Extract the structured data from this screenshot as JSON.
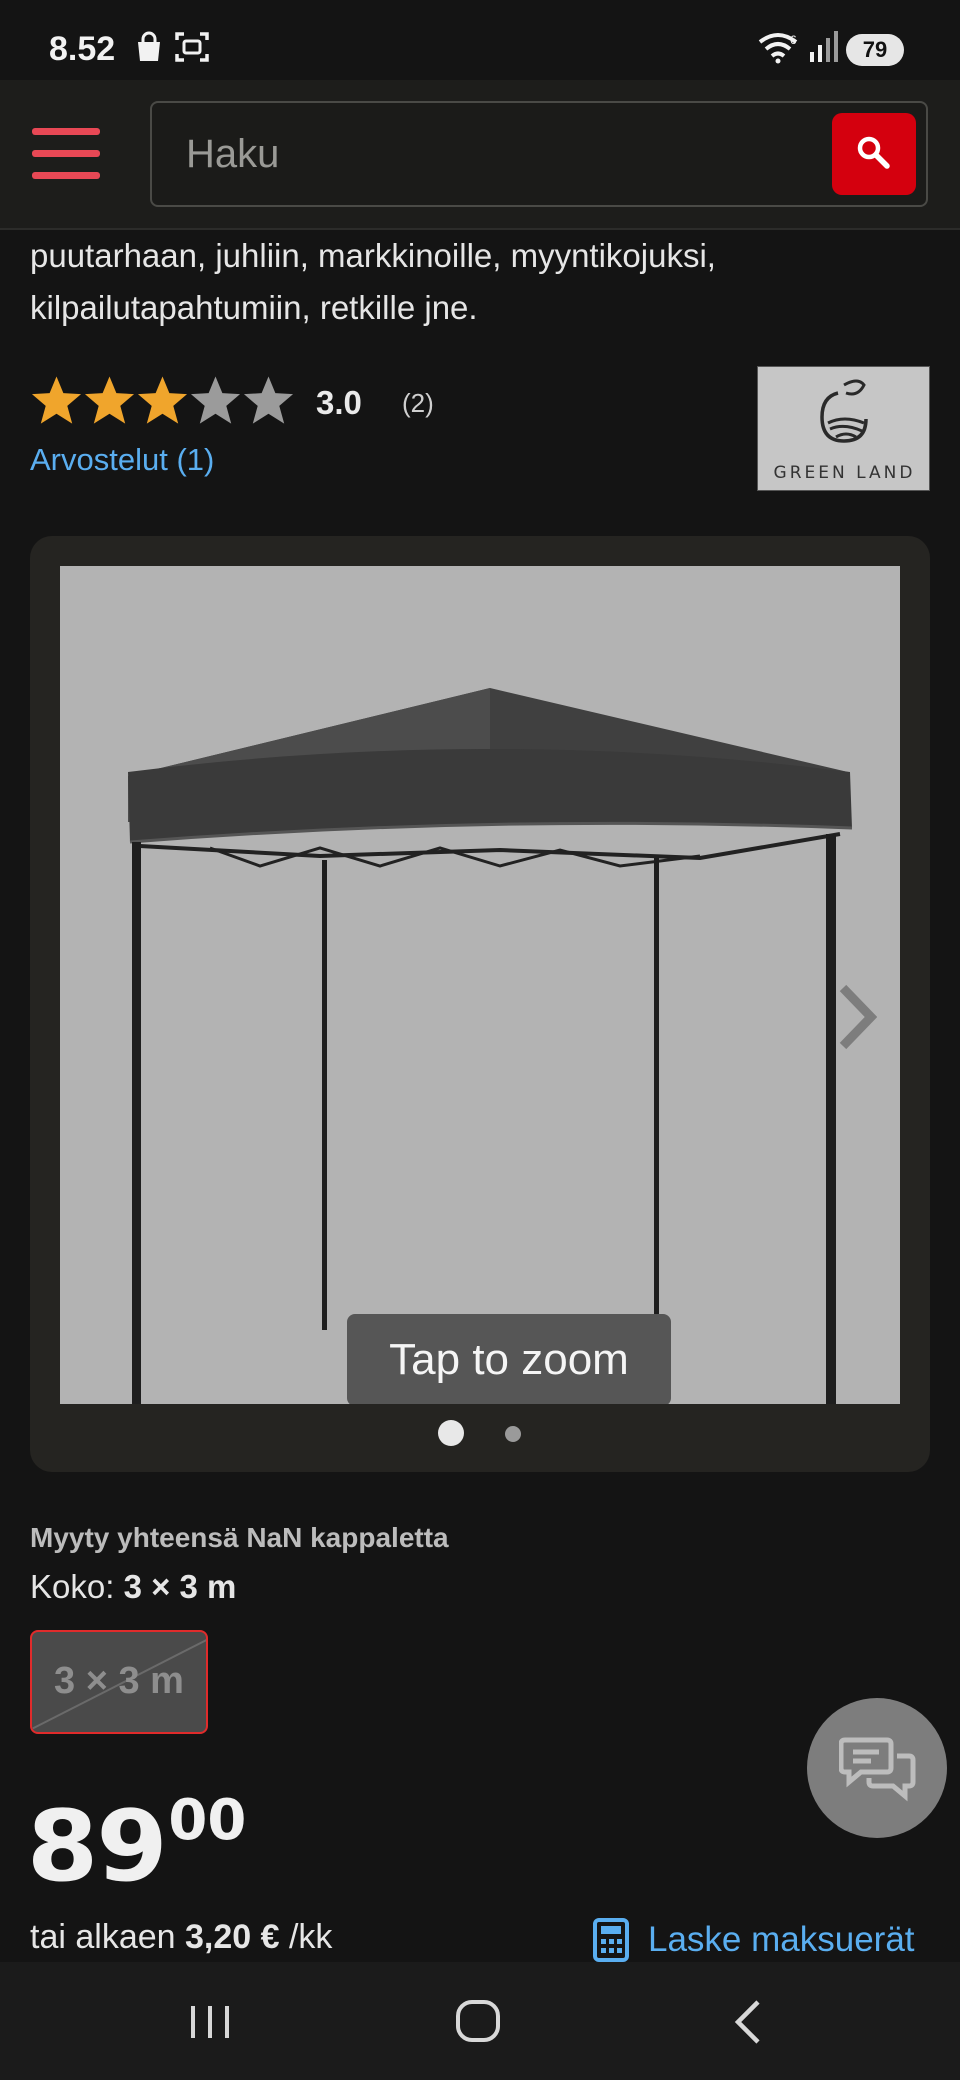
{
  "status_bar": {
    "time": "8.52",
    "battery": "79",
    "icons": [
      "shopping-bag-icon",
      "screenshot-icon",
      "wifi-icon",
      "signal-icon"
    ]
  },
  "header": {
    "search_placeholder": "Haku",
    "icons": [
      "menu-icon",
      "search-icon"
    ],
    "accent_color": "#d4000e",
    "menu_color": "#e84855"
  },
  "product": {
    "description_lines": [
      "puutarhaan, juhliin, markkinoille, myyntikojuksi,",
      "kilpailutapahtumiin, retkille jne."
    ],
    "rating": {
      "value": "3.0",
      "count": "(2)",
      "stars_filled": 3,
      "stars_total": 5,
      "reviews_link": "Arvostelut (1)"
    },
    "brand": {
      "name": "GREEN LAND"
    },
    "gallery": {
      "zoom_hint": "Tap to zoom",
      "current_image": 1,
      "image_count": 2
    },
    "sold_text": "Myyty yhteensä NaN kappaletta",
    "size": {
      "label": "Koko:",
      "selected": "3 × 3 m",
      "options": [
        "3 × 3 m"
      ]
    },
    "price": {
      "integer": "89",
      "decimals": "00"
    },
    "installment": {
      "prefix": "tai alkaen",
      "amount": "3,20 €",
      "suffix": "/kk",
      "calc_link": "Laske maksuerät"
    }
  },
  "colors": {
    "link": "#5aaef0",
    "star_filled": "#f0a52c",
    "star_empty": "#9b9b9b"
  },
  "navbar": {
    "buttons": [
      "recent-apps",
      "home",
      "back"
    ]
  }
}
